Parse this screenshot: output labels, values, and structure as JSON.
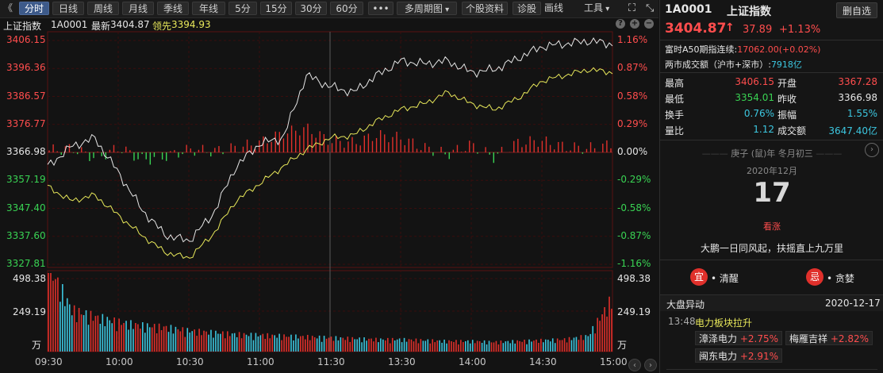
{
  "toolbar": {
    "back_glyph": "《",
    "buttons": [
      "分时",
      "日线",
      "周线",
      "月线",
      "季线",
      "年线",
      "5分",
      "15分",
      "30分",
      "60分",
      "•••",
      "多周期图",
      "个股资料",
      "诊股",
      "画线",
      "工具"
    ],
    "active": "分时",
    "multi_period_arrow": "▾",
    "tools_arrow": "▾",
    "fullscreen_icon": "fullscreen-icon",
    "collapse_icon": "collapse-icon"
  },
  "chart_header": {
    "index_name": "上证指数",
    "code": "1A0001",
    "latest_label": "最新",
    "latest_value": "3404.87",
    "leading_label": "领先",
    "leading_value": "3394.93",
    "help_icon": "?",
    "zoom_in_icon": "+",
    "zoom_out_icon": "−"
  },
  "price_axis_left": [
    "3406.15",
    "3396.36",
    "3386.57",
    "3376.77",
    "3366.98",
    "3357.19",
    "3347.40",
    "3337.60",
    "3327.81"
  ],
  "price_axis_right": [
    "1.16%",
    "0.87%",
    "0.58%",
    "0.29%",
    "0.00%",
    "-0.29%",
    "-0.58%",
    "-0.87%",
    "-1.16%"
  ],
  "volume_axis_left": [
    "498.38",
    "249.19",
    "万"
  ],
  "volume_axis_right": [
    "498.38",
    "249.19",
    "万"
  ],
  "time_axis": [
    "09:30",
    "10:00",
    "10:30",
    "11:00",
    "11:30",
    "13:30",
    "14:00",
    "14:30",
    "15:00"
  ],
  "colors": {
    "up": "#ff4d4d",
    "down": "#39d353",
    "price_line": "#e6e6e6",
    "lead_line": "#e8e85a",
    "volume_up": "#e0302b",
    "volume_down": "#3cc7e0",
    "grid": "#2b0a0a"
  },
  "chart_data": {
    "type": "line",
    "series": [],
    "price_range": [
      3327.81,
      3406.15
    ],
    "base_price": 3366.98,
    "time": [
      "09:30",
      "09:40",
      "09:50",
      "10:00",
      "10:10",
      "10:20",
      "10:30",
      "10:40",
      "10:50",
      "11:00",
      "11:10",
      "11:20",
      "11:30",
      "13:10",
      "13:20",
      "13:30",
      "13:40",
      "13:50",
      "14:00",
      "14:10",
      "14:20",
      "14:30",
      "14:40",
      "14:50",
      "15:00"
    ],
    "price": [
      3362,
      3369,
      3372,
      3360,
      3347,
      3338,
      3336,
      3345,
      3362,
      3370,
      3372,
      3394,
      3390,
      3388,
      3394,
      3399,
      3398,
      3399,
      3395,
      3396,
      3400,
      3404,
      3405,
      3406,
      3404.87
    ],
    "leading": [
      3355,
      3350,
      3352,
      3345,
      3338,
      3332,
      3330,
      3338,
      3350,
      3356,
      3362,
      3368,
      3372,
      3373,
      3378,
      3382,
      3384,
      3388,
      3384,
      3382,
      3386,
      3392,
      3394,
      3396,
      3394.93
    ],
    "volume_max": 498.38,
    "volume": [
      498,
      240,
      200,
      170,
      150,
      140,
      120,
      110,
      100,
      95,
      90,
      85,
      80,
      75,
      70,
      70,
      65,
      60,
      60,
      55,
      60,
      65,
      70,
      90,
      300
    ],
    "indicator_range": [
      -0.29,
      0.29
    ],
    "indicator": [
      0.02,
      0.04,
      -0.06,
      0.05,
      -0.08,
      -0.04,
      0.03,
      0.01,
      0.05,
      0.1,
      0.2,
      0.25,
      0.12,
      0.1,
      0.18,
      0.15,
      0.05,
      -0.02,
      0.08,
      -0.05,
      0.1,
      0.12,
      0.06,
      0.04,
      0.08
    ]
  },
  "right_panel": {
    "code": "1A0001",
    "name": "上证指数",
    "delete_button": "删自选",
    "price": "3404.87",
    "arrow": "↑",
    "change": "37.89",
    "change_pct": "+1.13%",
    "a50_label": "富时A50期指连续:",
    "a50_value": "17062.00(+0.02%)",
    "market_turnover_label": "两市成交额（沪市+深市）:",
    "market_turnover_value": "7918亿",
    "stats": [
      {
        "l1": "最高",
        "v1": "3406.15",
        "c1": "red",
        "l2": "开盘",
        "v2": "3367.28",
        "c2": "red"
      },
      {
        "l1": "最低",
        "v1": "3354.01",
        "c1": "green",
        "l2": "昨收",
        "v2": "3366.98",
        "c2": "white"
      },
      {
        "l1": "换手",
        "v1": "0.76%",
        "c1": "cyan",
        "l2": "振幅",
        "v2": "1.55%",
        "c2": "cyan"
      },
      {
        "l1": "量比",
        "v1": "1.12",
        "c1": "cyan",
        "l2": "成交额",
        "v2": "3647.40亿",
        "c2": "cyan"
      }
    ],
    "lunar": "庚子 (鼠)年 冬月初三",
    "calendar_month": "2020年12月",
    "calendar_day": "17",
    "calendar_note": "看涨",
    "motto": "大鹏一日同风起，扶摇直上九万里",
    "yi_badge": "宜",
    "yi_text": "• 清醒",
    "ji_badge": "忌",
    "ji_text": "• 贪婪",
    "movement_title": "大盘异动",
    "movement_date": "2020-12-17",
    "movement_time": "13:48",
    "movement_event": "电力板块拉升",
    "stocks": [
      {
        "name": "漳泽电力",
        "pct": "+2.75%"
      },
      {
        "name": "梅雁吉祥",
        "pct": "+2.82%"
      },
      {
        "name": "闽东电力",
        "pct": "+2.91%"
      }
    ],
    "circle_icon": "info-circle-icon",
    "scroll_icon": "scroll-icon"
  }
}
